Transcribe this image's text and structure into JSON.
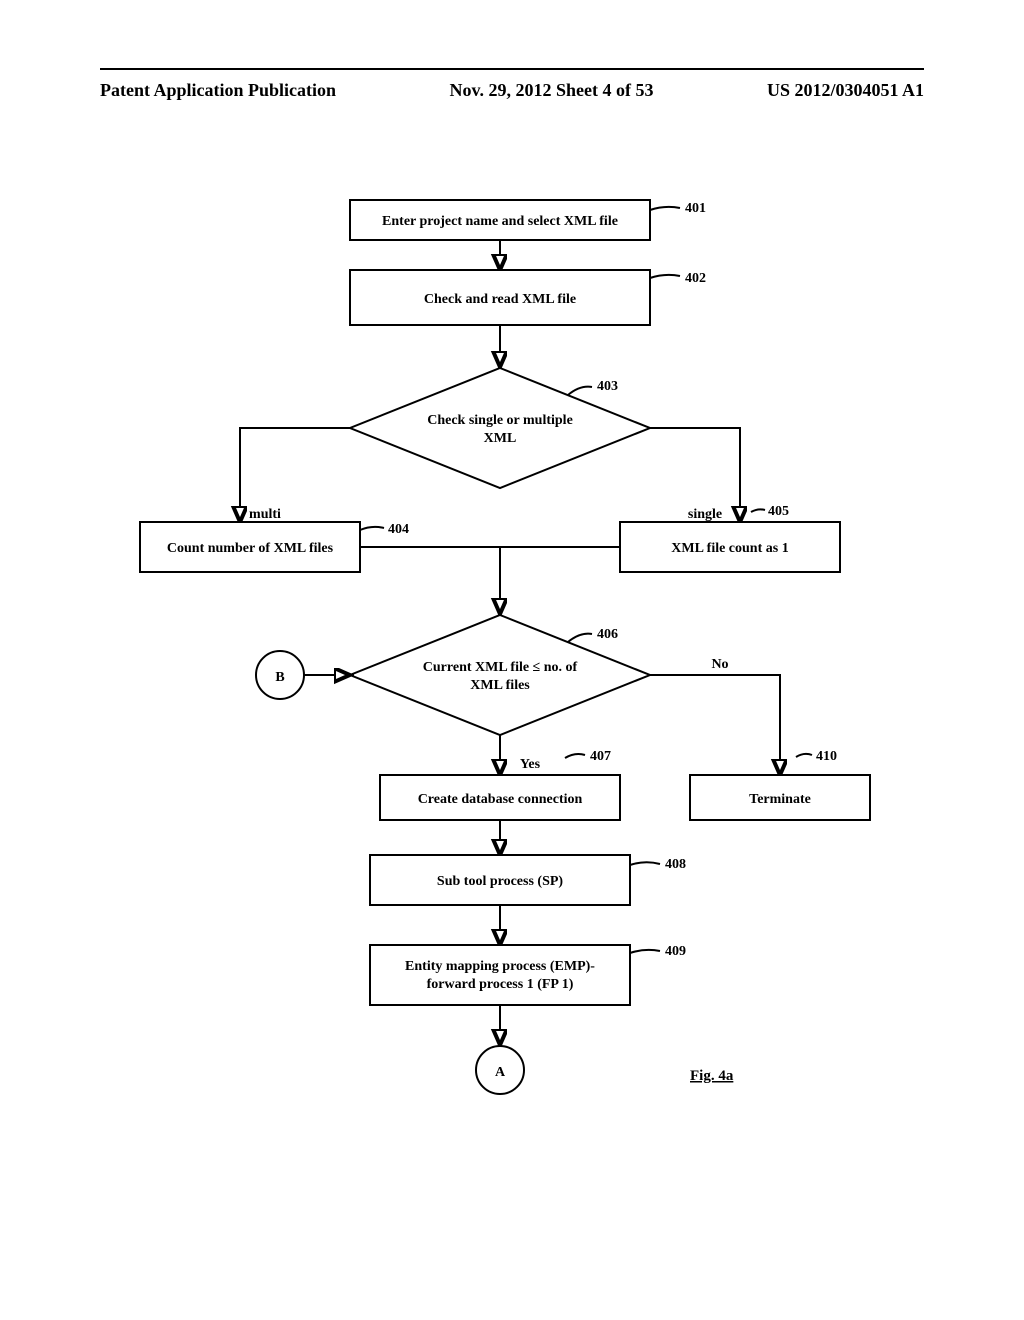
{
  "header": {
    "left": "Patent Application Publication",
    "center": "Nov. 29, 2012  Sheet 4 of 53",
    "right": "US 2012/0304051 A1"
  },
  "caption": "Fig. 4a",
  "labels": {
    "n401": "401",
    "n402": "402",
    "n403": "403",
    "n404": "404",
    "n405": "405",
    "n406": "406",
    "n407": "407",
    "n408": "408",
    "n409": "409",
    "n410": "410"
  },
  "branches": {
    "multi": "multi",
    "single": "single",
    "yes": "Yes",
    "no": "No"
  },
  "connectors": {
    "A": "A",
    "B": "B"
  },
  "nodes": {
    "n401": "Enter project name and select XML file",
    "n402": "Check and read XML file",
    "n403": {
      "line1": "Check single or multiple",
      "line2": "XML"
    },
    "n404": "Count number of XML files",
    "n405": "XML file count as 1",
    "n406": {
      "line1": "Current XML file ≤ no. of",
      "line2": "XML files"
    },
    "n407": "Create database connection",
    "n408": "Sub tool process (SP)",
    "n409": {
      "line1": "Entity mapping process (EMP)-",
      "line2": "forward process 1 (FP 1)"
    },
    "n410": "Terminate"
  }
}
